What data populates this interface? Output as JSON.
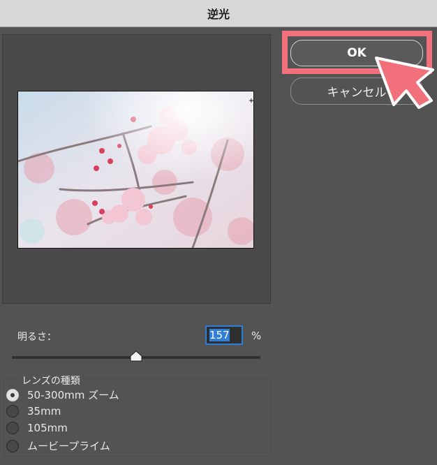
{
  "window": {
    "title": "逆光"
  },
  "buttons": {
    "ok_label": "OK",
    "cancel_label": "キャンセル"
  },
  "brightness": {
    "label": "明るさ：",
    "value": "157",
    "unit": "%",
    "slider_fraction": 0.5
  },
  "lens": {
    "title": "レンズの種類",
    "options": [
      {
        "label": "50-300mm ズーム",
        "checked": true
      },
      {
        "label": "35mm",
        "checked": false
      },
      {
        "label": "105mm",
        "checked": false
      },
      {
        "label": "ムービープライム",
        "checked": false
      }
    ]
  },
  "colors": {
    "highlight": "#f1707b",
    "selection": "#2f7fd9"
  }
}
